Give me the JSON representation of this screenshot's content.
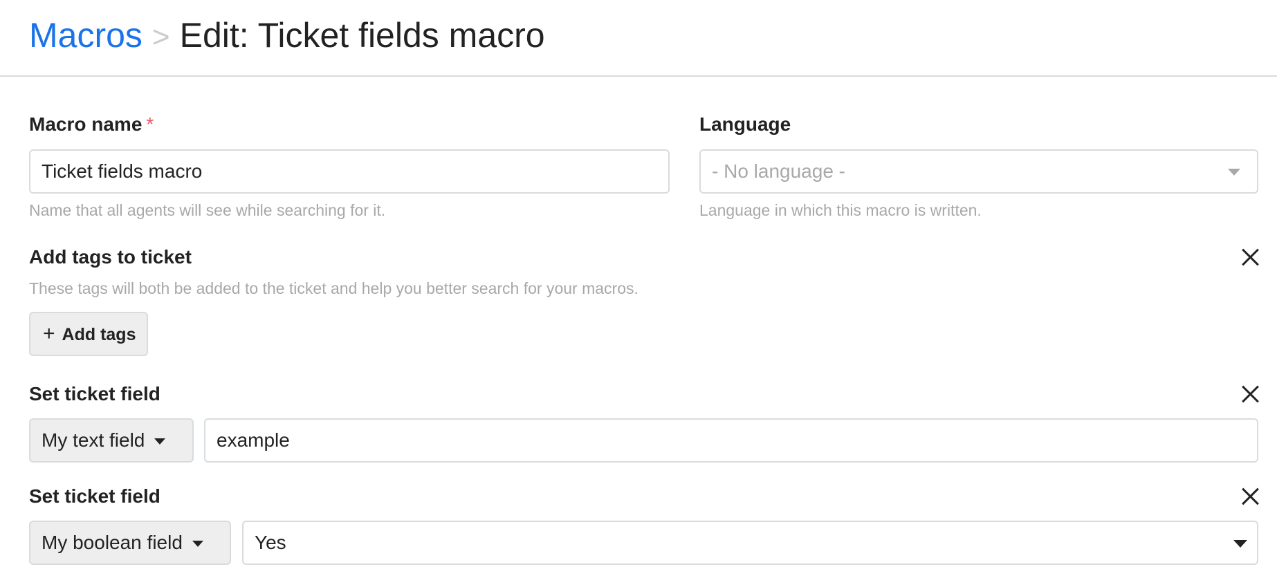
{
  "header": {
    "breadcrumb_link": "Macros",
    "breadcrumb_separator": ">",
    "title": "Edit: Ticket fields macro"
  },
  "macro_name": {
    "label": "Macro name",
    "required_marker": "*",
    "value": "Ticket fields macro",
    "hint": "Name that all agents will see while searching for it."
  },
  "language": {
    "label": "Language",
    "placeholder": "- No language -",
    "hint": "Language in which this macro is written."
  },
  "tags": {
    "label": "Add tags to ticket",
    "hint": "These tags will both be added to the ticket and help you better search for your macros.",
    "add_button_icon": "+",
    "add_button_label": "Add tags"
  },
  "actions": [
    {
      "label": "Set ticket field",
      "field": "My text field",
      "value": "example"
    },
    {
      "label": "Set ticket field",
      "field": "My boolean field",
      "value": "Yes"
    }
  ]
}
